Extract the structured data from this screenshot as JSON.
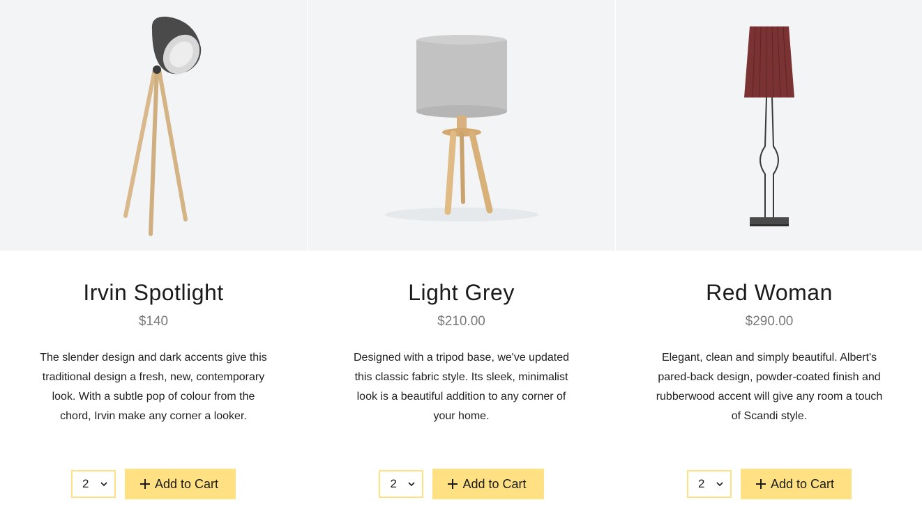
{
  "products": [
    {
      "name": "Irvin Spotlight",
      "price": "$140",
      "description": "The slender design and dark accents give this traditional design a fresh, new, contemporary look. With a subtle pop of colour from the chord, Irvin make any corner a looker.",
      "quantity": "2",
      "add_label": "Add to Cart",
      "image_icon": "tripod-spotlight-lamp"
    },
    {
      "name": "Light Grey",
      "price": "$210.00",
      "description": "Designed with a tripod base, we've updated this classic fabric style. Its sleek, minimalist look is a beautiful addition to any corner of your home.",
      "quantity": "2",
      "add_label": "Add to Cart",
      "image_icon": "grey-shade-tripod-lamp"
    },
    {
      "name": "Red Woman",
      "price": "$290.00",
      "description": "Elegant, clean and simply beautiful. Albert's pared-back design, powder-coated finish and rubberwood accent will give any room a touch of Scandi style.",
      "quantity": "2",
      "add_label": "Add to Cart",
      "image_icon": "red-pleated-floor-lamp"
    }
  ],
  "colors": {
    "accent": "#ffe082",
    "image_bg": "#f2f4f6",
    "price": "#7a7a7a"
  }
}
